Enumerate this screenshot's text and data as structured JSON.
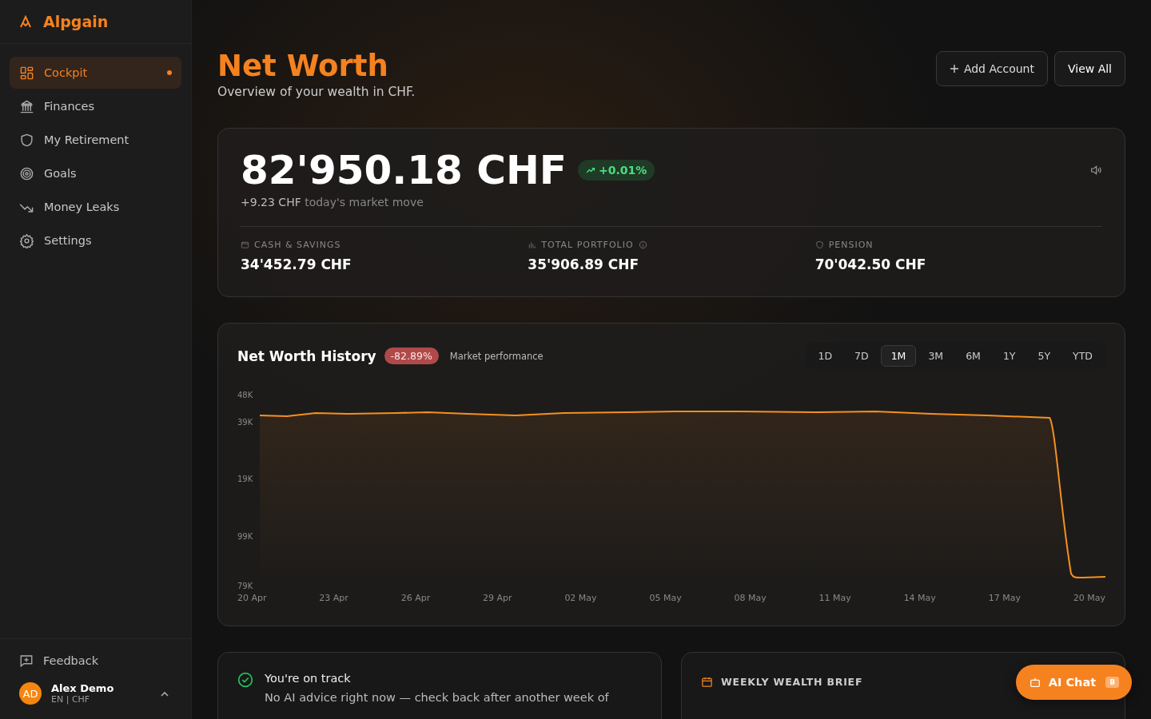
{
  "brand": {
    "name": "Alpgain"
  },
  "sidebar": {
    "items": [
      {
        "label": "Cockpit",
        "selected": true,
        "dot": true
      },
      {
        "label": "Finances",
        "selected": false,
        "dot": false
      },
      {
        "label": "My Retirement",
        "selected": false,
        "dot": false
      },
      {
        "label": "Goals",
        "selected": false,
        "dot": false
      },
      {
        "label": "Money Leaks",
        "selected": false,
        "dot": false
      },
      {
        "label": "Settings",
        "selected": false,
        "dot": false
      }
    ],
    "feedback": "Feedback",
    "user": {
      "initials": "AD",
      "name": "Alex Demo",
      "meta": "EN | CHF"
    }
  },
  "header": {
    "title": "Net Worth",
    "subtitle": "Overview of your wealth in CHF.",
    "buttons": [
      {
        "label": "Add Account"
      },
      {
        "label": "View All"
      }
    ]
  },
  "summary": {
    "total": "82'950.18 CHF",
    "change": {
      "text": "+0.01%",
      "positive": true
    },
    "move_amount": "+9.23 CHF",
    "move_label": "today's market move",
    "stats": [
      {
        "label": "CASH & SAVINGS",
        "value": "34'452.79 CHF",
        "info": false
      },
      {
        "label": "TOTAL PORTFOLIO",
        "value": "35'906.89 CHF",
        "info": true
      },
      {
        "label": "PENSION",
        "value": "70'042.50 CHF",
        "info": false
      }
    ]
  },
  "history": {
    "title": "Net Worth History",
    "change": {
      "text": "-82.89%",
      "positive": false
    },
    "caption": "Market performance",
    "ranges": [
      {
        "label": "1D",
        "selected": false
      },
      {
        "label": "7D",
        "selected": false
      },
      {
        "label": "1M",
        "selected": true
      },
      {
        "label": "3M",
        "selected": false
      },
      {
        "label": "6M",
        "selected": false
      },
      {
        "label": "1Y",
        "selected": false
      },
      {
        "label": "5Y",
        "selected": false
      },
      {
        "label": "YTD",
        "selected": false
      }
    ],
    "y_labels": [
      "48K",
      "39K",
      "19K",
      "99K",
      "79K"
    ],
    "x_labels": [
      "20 Apr",
      "23 Apr",
      "26 Apr",
      "29 Apr",
      "02 May",
      "05 May",
      "08 May",
      "11 May",
      "14 May",
      "17 May",
      "20 May"
    ]
  },
  "status_card": {
    "title": "You're on track",
    "text": "No AI advice right now — check back after another week of"
  },
  "brief_card": {
    "title": "WEEKLY WEALTH BRIEF"
  },
  "chat_button": {
    "label": "AI Chat",
    "badge": "B"
  }
}
